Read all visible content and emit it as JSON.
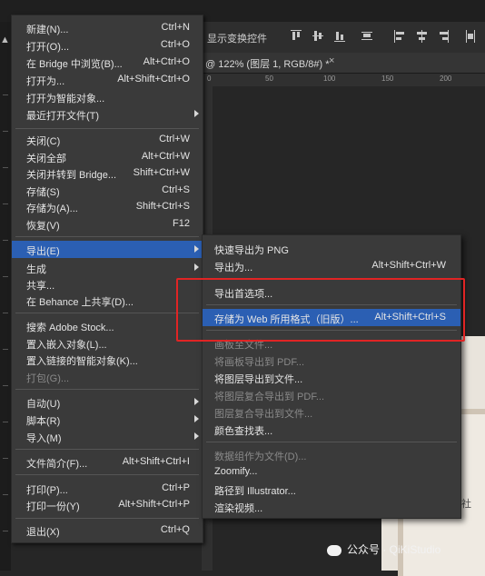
{
  "toolbar": {
    "show_transform_controls": "显示变换控件"
  },
  "document_tab": {
    "title": "@ 122% (图层 1, RGB/8#) *",
    "close": "×"
  },
  "ruler": {
    "labels": [
      "0",
      "50",
      "100",
      "150",
      "200"
    ]
  },
  "file_menu": {
    "items": [
      {
        "label": "新建(N)...",
        "shortcut": "Ctrl+N"
      },
      {
        "label": "打开(O)...",
        "shortcut": "Ctrl+O"
      },
      {
        "label": "在 Bridge 中浏览(B)...",
        "shortcut": "Alt+Ctrl+O"
      },
      {
        "label": "打开为...",
        "shortcut": "Alt+Shift+Ctrl+O"
      },
      {
        "label": "打开为智能对象..."
      },
      {
        "label": "最近打开文件(T)"
      },
      {
        "label": "关闭(C)",
        "shortcut": "Ctrl+W"
      },
      {
        "label": "关闭全部",
        "shortcut": "Alt+Ctrl+W"
      },
      {
        "label": "关闭并转到 Bridge...",
        "shortcut": "Shift+Ctrl+W"
      },
      {
        "label": "存储(S)",
        "shortcut": "Ctrl+S"
      },
      {
        "label": "存储为(A)...",
        "shortcut": "Shift+Ctrl+S"
      },
      {
        "label": "恢复(V)",
        "shortcut": "F12"
      },
      {
        "label": "导出(E)"
      },
      {
        "label": "生成"
      },
      {
        "label": "共享..."
      },
      {
        "label": "在 Behance 上共享(D)..."
      },
      {
        "label": "搜索 Adobe Stock..."
      },
      {
        "label": "置入嵌入对象(L)..."
      },
      {
        "label": "置入链接的智能对象(K)..."
      },
      {
        "label": "打包(G)..."
      },
      {
        "label": "自动(U)"
      },
      {
        "label": "脚本(R)"
      },
      {
        "label": "导入(M)"
      },
      {
        "label": "文件简介(F)...",
        "shortcut": "Alt+Shift+Ctrl+I"
      },
      {
        "label": "打印(P)...",
        "shortcut": "Ctrl+P"
      },
      {
        "label": "打印一份(Y)",
        "shortcut": "Alt+Shift+Ctrl+P"
      },
      {
        "label": "退出(X)",
        "shortcut": "Ctrl+Q"
      }
    ]
  },
  "export_submenu": {
    "items": [
      {
        "label": "快速导出为 PNG"
      },
      {
        "label": "导出为...",
        "shortcut": "Alt+Shift+Ctrl+W"
      },
      {
        "label": "导出首选项..."
      },
      {
        "label": "存储为 Web 所用格式（旧版）...",
        "shortcut": "Alt+Shift+Ctrl+S"
      },
      {
        "label": "画板至文件..."
      },
      {
        "label": "将画板导出到 PDF..."
      },
      {
        "label": "将图层导出到文件..."
      },
      {
        "label": "将图层复合导出到 PDF..."
      },
      {
        "label": "图层复合导出到文件..."
      },
      {
        "label": "颜色查找表..."
      },
      {
        "label": "数据组作为文件(D)..."
      },
      {
        "label": "Zoomify..."
      },
      {
        "label": "路径到 Illustrator..."
      },
      {
        "label": "渲染视频..."
      }
    ]
  },
  "canvas": {
    "visible_char": "社"
  },
  "watermark": {
    "text": "公众号 · QiKiStudio"
  },
  "colors": {
    "menu_bg": "#3a3a3a",
    "highlight": "#2b5fb3",
    "annotation_box": "#e02424"
  }
}
